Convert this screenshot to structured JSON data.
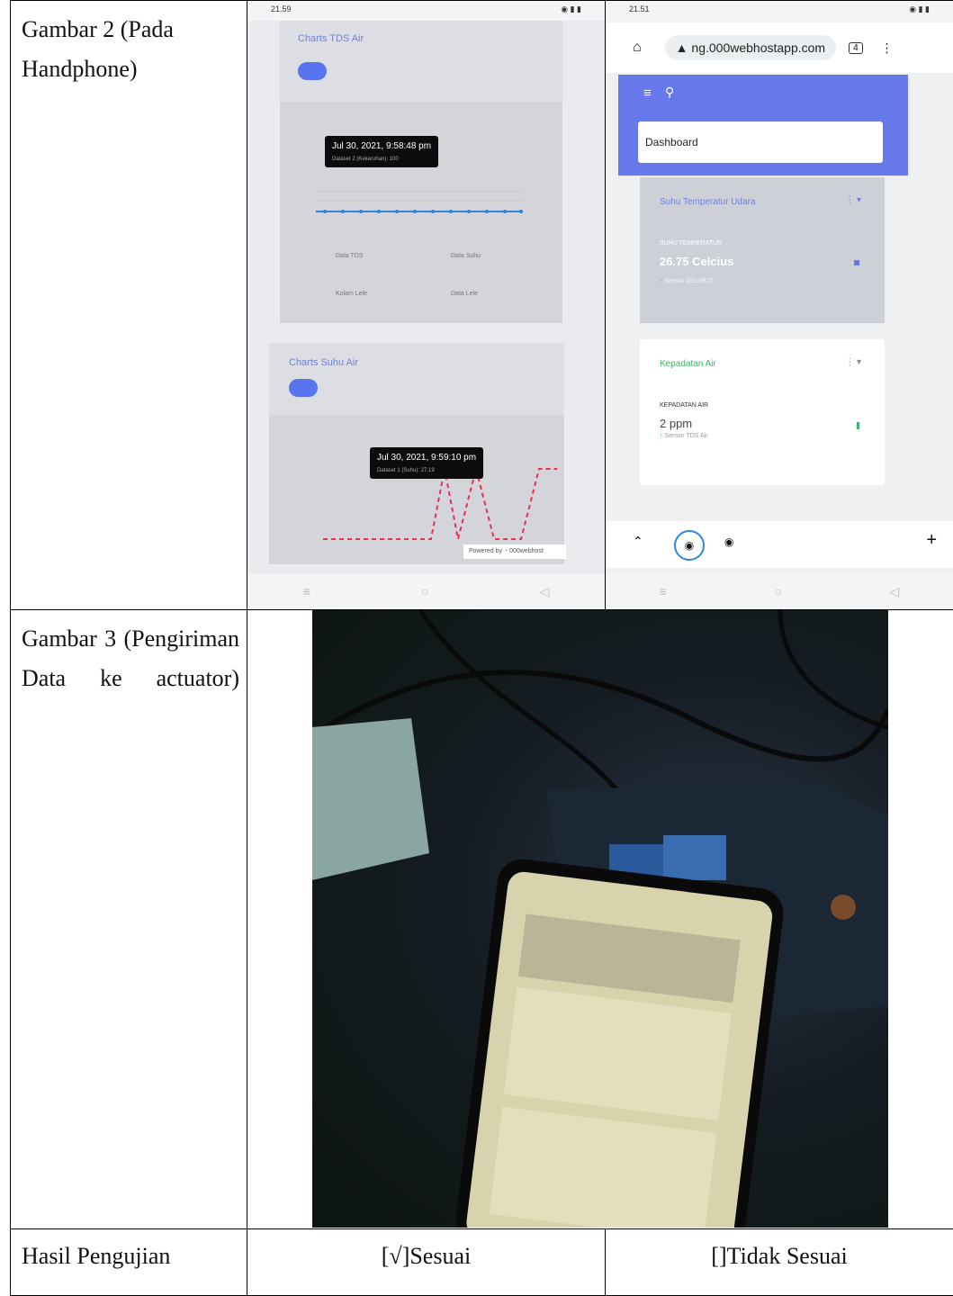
{
  "rows": [
    {
      "label": "Gambar 2 (Pada Handphone)"
    },
    {
      "label": "Gambar 3 (Pengiriman Data ke actuator)"
    },
    {
      "label": "Hasil Pengujian"
    }
  ],
  "phone_left": {
    "status_time": "21.59",
    "chart1_title": "Charts TDS Air",
    "chart1_tooltip_date": "Jul 30, 2021, 9:58:48 pm",
    "chart1_tooltip_sub": "Dataset 2 (Kekeruhan): 100",
    "btn_data_tds": "Data TDS",
    "btn_data_suhu": "Data Suhu",
    "btn_kolam_lele": "Kolam Lele",
    "btn_data_lele": "Data Lele",
    "chart2_title": "Charts Suhu Air",
    "chart2_tooltip_date": "Jul 30, 2021, 9:59:10 pm",
    "chart2_tooltip_sub": "Dataset 1 (Suhu): 27.19",
    "powered": "Powered by",
    "powered_brand": "000webhost"
  },
  "phone_right": {
    "status_time": "21.51",
    "url": "ng.000webhostapp.com",
    "tab_count": "4",
    "dashboard": "Dashboard",
    "card1_title": "Suhu Temperatur Udara",
    "card1_label": "SUHU TEMPERATUR",
    "card1_value": "26.75 Celcius",
    "card1_sensor": "Sensor DS18B20",
    "card2_title": "Kepadatan Air",
    "card2_label": "KEPADATAN AIR",
    "card2_value": "2 ppm",
    "card2_sensor": "Sensor TDS Air"
  },
  "result": {
    "sesuai": "[√]Sesuai",
    "tidak_sesuai": "[]Tidak Sesuai"
  },
  "colors": {
    "accent": "#5a74f0",
    "green": "#3fb36d",
    "dashed": "#e8304f",
    "line_blue": "#2e86de"
  }
}
